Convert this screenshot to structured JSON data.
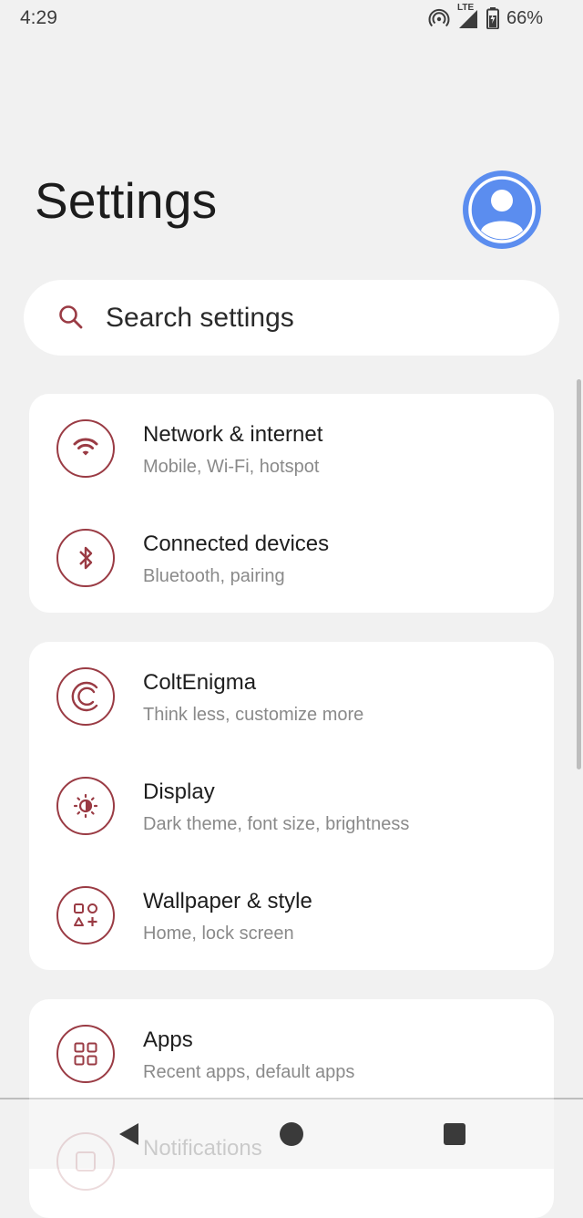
{
  "status_bar": {
    "time": "4:29",
    "network_label": "LTE",
    "battery_percent": "66%",
    "icons": [
      "hotspot-icon",
      "signal-icon",
      "battery-charging-icon"
    ]
  },
  "header": {
    "title": "Settings",
    "avatar_icon": "account-circle-icon",
    "avatar_color": "#5b8def"
  },
  "search": {
    "placeholder": "Search settings",
    "icon": "search-icon"
  },
  "accent_color": "#9a3b44",
  "sections": [
    {
      "items": [
        {
          "title": "Network & internet",
          "subtitle": "Mobile, Wi-Fi, hotspot",
          "icon": "wifi-icon"
        },
        {
          "title": "Connected devices",
          "subtitle": "Bluetooth, pairing",
          "icon": "bluetooth-icon"
        }
      ]
    },
    {
      "items": [
        {
          "title": "ColtEnigma",
          "subtitle": "Think less, customize more",
          "icon": "colt-logo-icon"
        },
        {
          "title": "Display",
          "subtitle": "Dark theme, font size, brightness",
          "icon": "brightness-icon"
        },
        {
          "title": "Wallpaper & style",
          "subtitle": "Home, lock screen",
          "icon": "palette-shapes-icon"
        }
      ]
    },
    {
      "items": [
        {
          "title": "Apps",
          "subtitle": "Recent apps, default apps",
          "icon": "apps-grid-icon"
        },
        {
          "title": "Notifications",
          "subtitle": "",
          "icon": "notifications-icon"
        }
      ]
    }
  ],
  "nav_bar": {
    "buttons": [
      "back-icon",
      "home-icon",
      "recents-icon"
    ]
  }
}
